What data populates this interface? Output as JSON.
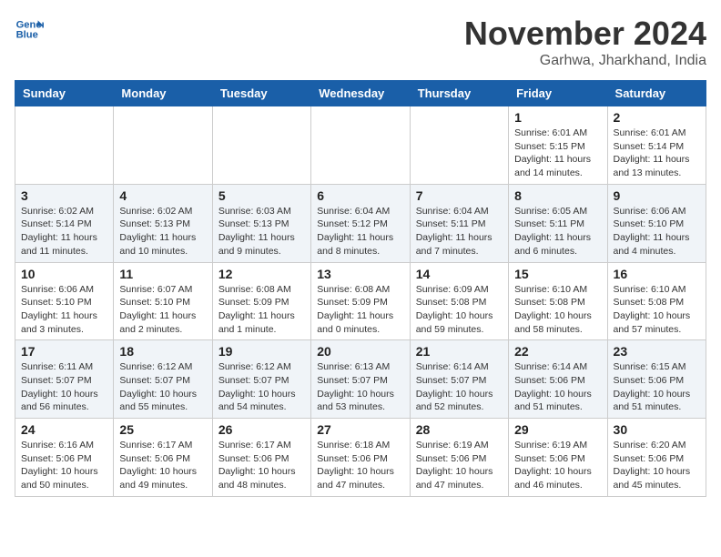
{
  "header": {
    "logo_line1": "General",
    "logo_line2": "Blue",
    "month": "November 2024",
    "location": "Garhwa, Jharkhand, India"
  },
  "weekdays": [
    "Sunday",
    "Monday",
    "Tuesday",
    "Wednesday",
    "Thursday",
    "Friday",
    "Saturday"
  ],
  "weeks": [
    [
      {
        "day": "",
        "info": ""
      },
      {
        "day": "",
        "info": ""
      },
      {
        "day": "",
        "info": ""
      },
      {
        "day": "",
        "info": ""
      },
      {
        "day": "",
        "info": ""
      },
      {
        "day": "1",
        "info": "Sunrise: 6:01 AM\nSunset: 5:15 PM\nDaylight: 11 hours and 14 minutes."
      },
      {
        "day": "2",
        "info": "Sunrise: 6:01 AM\nSunset: 5:14 PM\nDaylight: 11 hours and 13 minutes."
      }
    ],
    [
      {
        "day": "3",
        "info": "Sunrise: 6:02 AM\nSunset: 5:14 PM\nDaylight: 11 hours and 11 minutes."
      },
      {
        "day": "4",
        "info": "Sunrise: 6:02 AM\nSunset: 5:13 PM\nDaylight: 11 hours and 10 minutes."
      },
      {
        "day": "5",
        "info": "Sunrise: 6:03 AM\nSunset: 5:13 PM\nDaylight: 11 hours and 9 minutes."
      },
      {
        "day": "6",
        "info": "Sunrise: 6:04 AM\nSunset: 5:12 PM\nDaylight: 11 hours and 8 minutes."
      },
      {
        "day": "7",
        "info": "Sunrise: 6:04 AM\nSunset: 5:11 PM\nDaylight: 11 hours and 7 minutes."
      },
      {
        "day": "8",
        "info": "Sunrise: 6:05 AM\nSunset: 5:11 PM\nDaylight: 11 hours and 6 minutes."
      },
      {
        "day": "9",
        "info": "Sunrise: 6:06 AM\nSunset: 5:10 PM\nDaylight: 11 hours and 4 minutes."
      }
    ],
    [
      {
        "day": "10",
        "info": "Sunrise: 6:06 AM\nSunset: 5:10 PM\nDaylight: 11 hours and 3 minutes."
      },
      {
        "day": "11",
        "info": "Sunrise: 6:07 AM\nSunset: 5:10 PM\nDaylight: 11 hours and 2 minutes."
      },
      {
        "day": "12",
        "info": "Sunrise: 6:08 AM\nSunset: 5:09 PM\nDaylight: 11 hours and 1 minute."
      },
      {
        "day": "13",
        "info": "Sunrise: 6:08 AM\nSunset: 5:09 PM\nDaylight: 11 hours and 0 minutes."
      },
      {
        "day": "14",
        "info": "Sunrise: 6:09 AM\nSunset: 5:08 PM\nDaylight: 10 hours and 59 minutes."
      },
      {
        "day": "15",
        "info": "Sunrise: 6:10 AM\nSunset: 5:08 PM\nDaylight: 10 hours and 58 minutes."
      },
      {
        "day": "16",
        "info": "Sunrise: 6:10 AM\nSunset: 5:08 PM\nDaylight: 10 hours and 57 minutes."
      }
    ],
    [
      {
        "day": "17",
        "info": "Sunrise: 6:11 AM\nSunset: 5:07 PM\nDaylight: 10 hours and 56 minutes."
      },
      {
        "day": "18",
        "info": "Sunrise: 6:12 AM\nSunset: 5:07 PM\nDaylight: 10 hours and 55 minutes."
      },
      {
        "day": "19",
        "info": "Sunrise: 6:12 AM\nSunset: 5:07 PM\nDaylight: 10 hours and 54 minutes."
      },
      {
        "day": "20",
        "info": "Sunrise: 6:13 AM\nSunset: 5:07 PM\nDaylight: 10 hours and 53 minutes."
      },
      {
        "day": "21",
        "info": "Sunrise: 6:14 AM\nSunset: 5:07 PM\nDaylight: 10 hours and 52 minutes."
      },
      {
        "day": "22",
        "info": "Sunrise: 6:14 AM\nSunset: 5:06 PM\nDaylight: 10 hours and 51 minutes."
      },
      {
        "day": "23",
        "info": "Sunrise: 6:15 AM\nSunset: 5:06 PM\nDaylight: 10 hours and 51 minutes."
      }
    ],
    [
      {
        "day": "24",
        "info": "Sunrise: 6:16 AM\nSunset: 5:06 PM\nDaylight: 10 hours and 50 minutes."
      },
      {
        "day": "25",
        "info": "Sunrise: 6:17 AM\nSunset: 5:06 PM\nDaylight: 10 hours and 49 minutes."
      },
      {
        "day": "26",
        "info": "Sunrise: 6:17 AM\nSunset: 5:06 PM\nDaylight: 10 hours and 48 minutes."
      },
      {
        "day": "27",
        "info": "Sunrise: 6:18 AM\nSunset: 5:06 PM\nDaylight: 10 hours and 47 minutes."
      },
      {
        "day": "28",
        "info": "Sunrise: 6:19 AM\nSunset: 5:06 PM\nDaylight: 10 hours and 47 minutes."
      },
      {
        "day": "29",
        "info": "Sunrise: 6:19 AM\nSunset: 5:06 PM\nDaylight: 10 hours and 46 minutes."
      },
      {
        "day": "30",
        "info": "Sunrise: 6:20 AM\nSunset: 5:06 PM\nDaylight: 10 hours and 45 minutes."
      }
    ]
  ]
}
